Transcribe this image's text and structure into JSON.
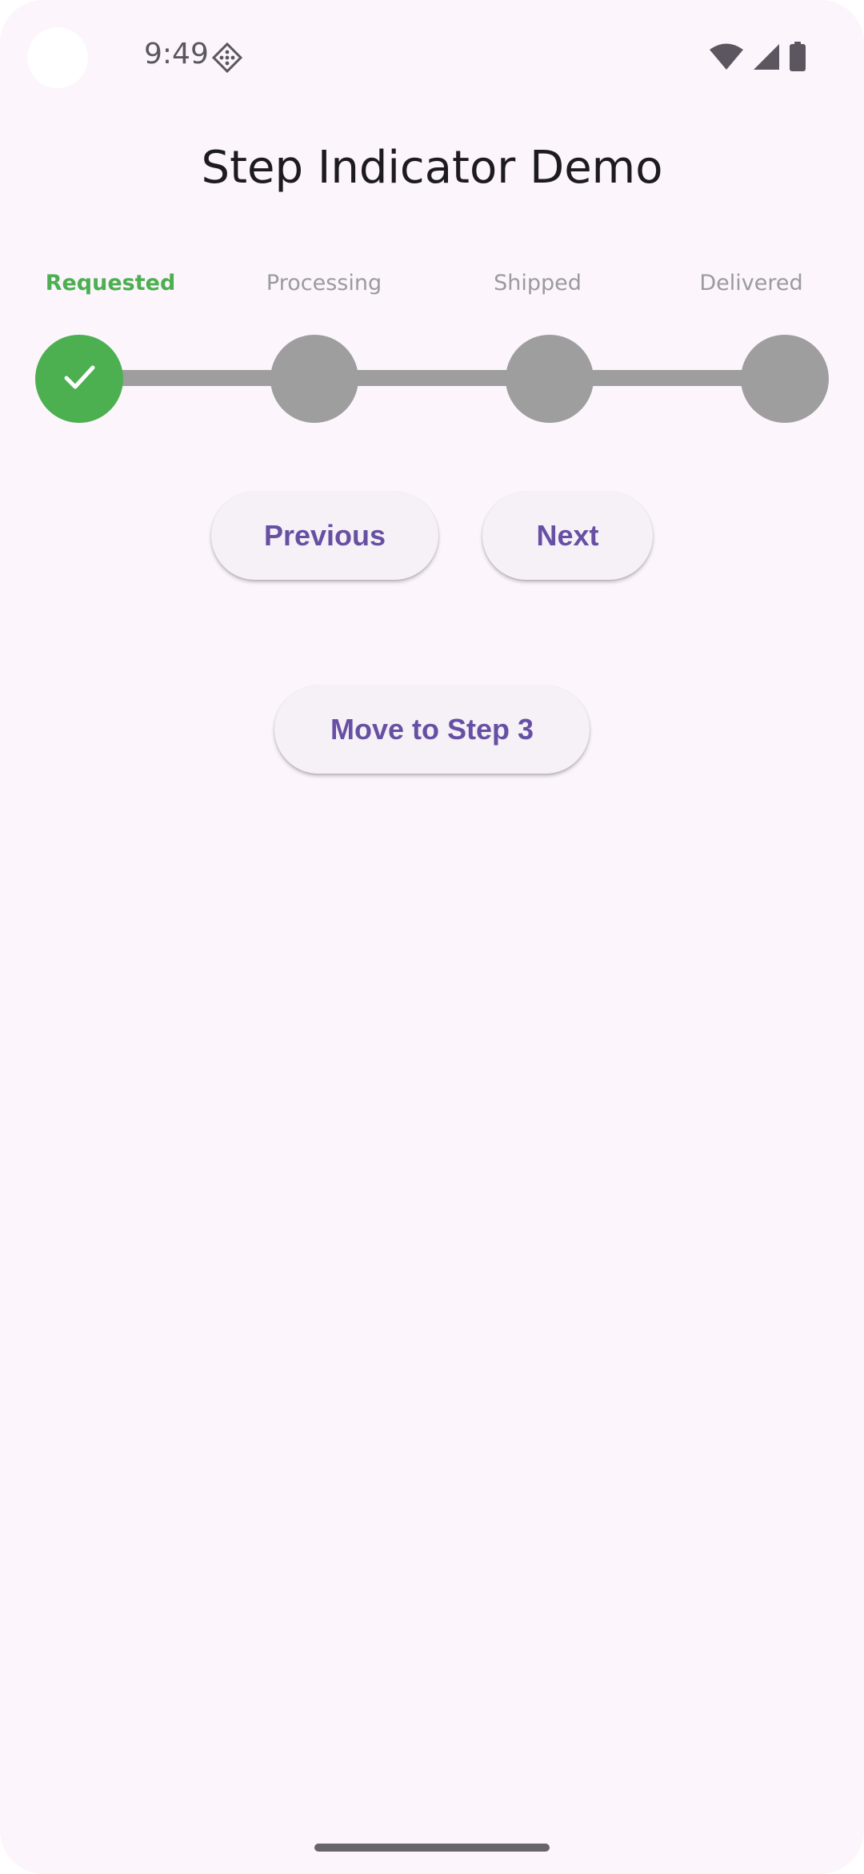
{
  "status_bar": {
    "time": "9:49",
    "app_icon": "diamond-grid-icon",
    "wifi_icon": "wifi-icon",
    "signal_icon": "cellular-signal-icon",
    "battery_icon": "battery-icon"
  },
  "page": {
    "title": "Step Indicator Demo"
  },
  "stepper": {
    "current_step": 1,
    "active_color": "#4caf50",
    "inactive_color": "#9e9e9e",
    "steps": [
      {
        "label": "Requested",
        "completed": true,
        "icon": "check-icon"
      },
      {
        "label": "Processing",
        "completed": false
      },
      {
        "label": "Shipped",
        "completed": false
      },
      {
        "label": "Delivered",
        "completed": false
      }
    ]
  },
  "buttons": {
    "previous_label": "Previous",
    "next_label": "Next",
    "move_label": "Move to Step 3",
    "text_color": "#6750a4"
  }
}
